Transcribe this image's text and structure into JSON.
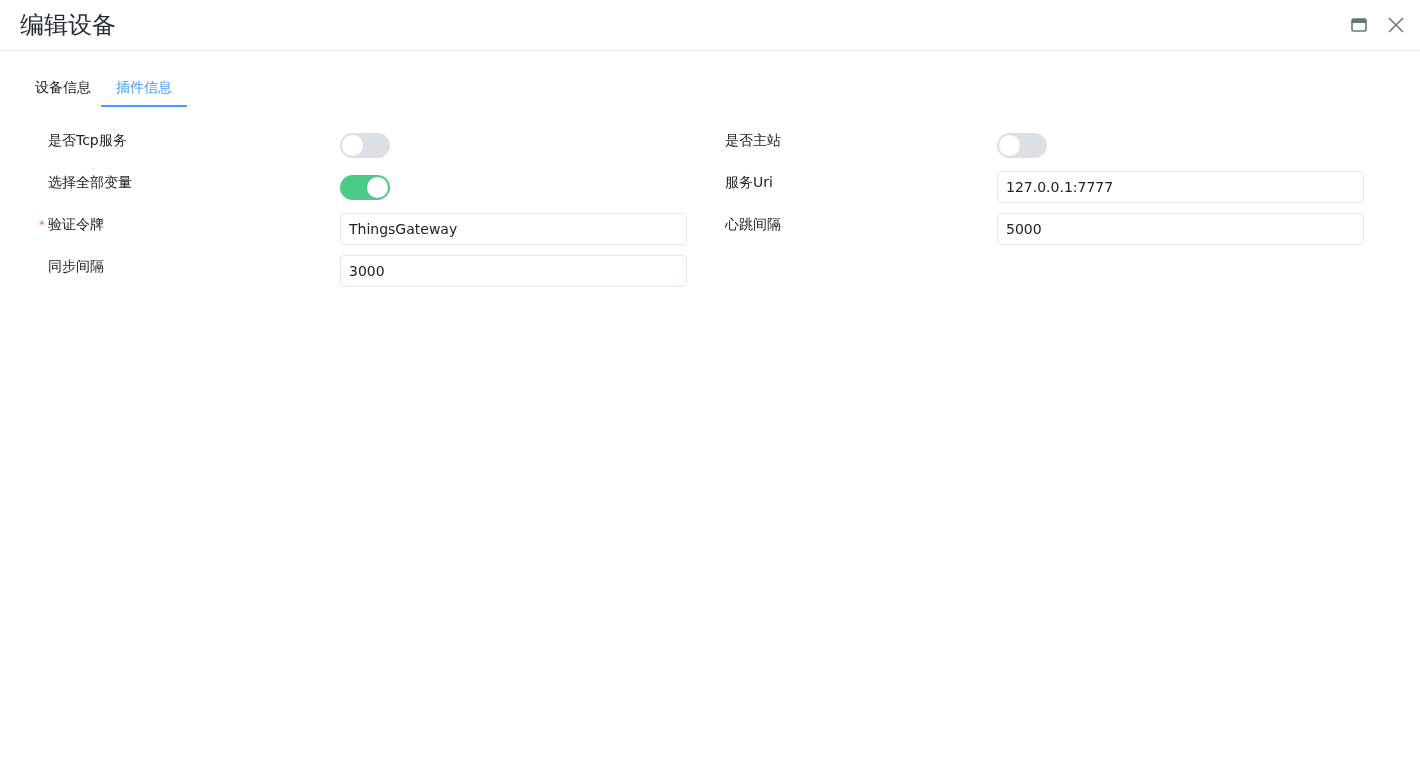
{
  "window": {
    "title": "编辑设备"
  },
  "tabs": [
    {
      "label": "设备信息",
      "selected": false
    },
    {
      "label": "插件信息",
      "selected": true
    }
  ],
  "fields": [
    {
      "kind": "switch",
      "label": "是否Tcp服务",
      "on": false
    },
    {
      "kind": "switch",
      "label": "是否主站",
      "on": false
    },
    {
      "kind": "switch",
      "label": "选择全部变量",
      "on": true
    },
    {
      "kind": "input",
      "label": "服务Uri",
      "value": "127.0.0.1:7777"
    },
    {
      "kind": "input",
      "label": "验证令牌",
      "required_mark": "*",
      "value": "ThingsGateway"
    },
    {
      "kind": "input",
      "label": "心跳间隔",
      "value": "5000"
    },
    {
      "kind": "input",
      "label": "同步间隔",
      "value": "3000"
    }
  ]
}
